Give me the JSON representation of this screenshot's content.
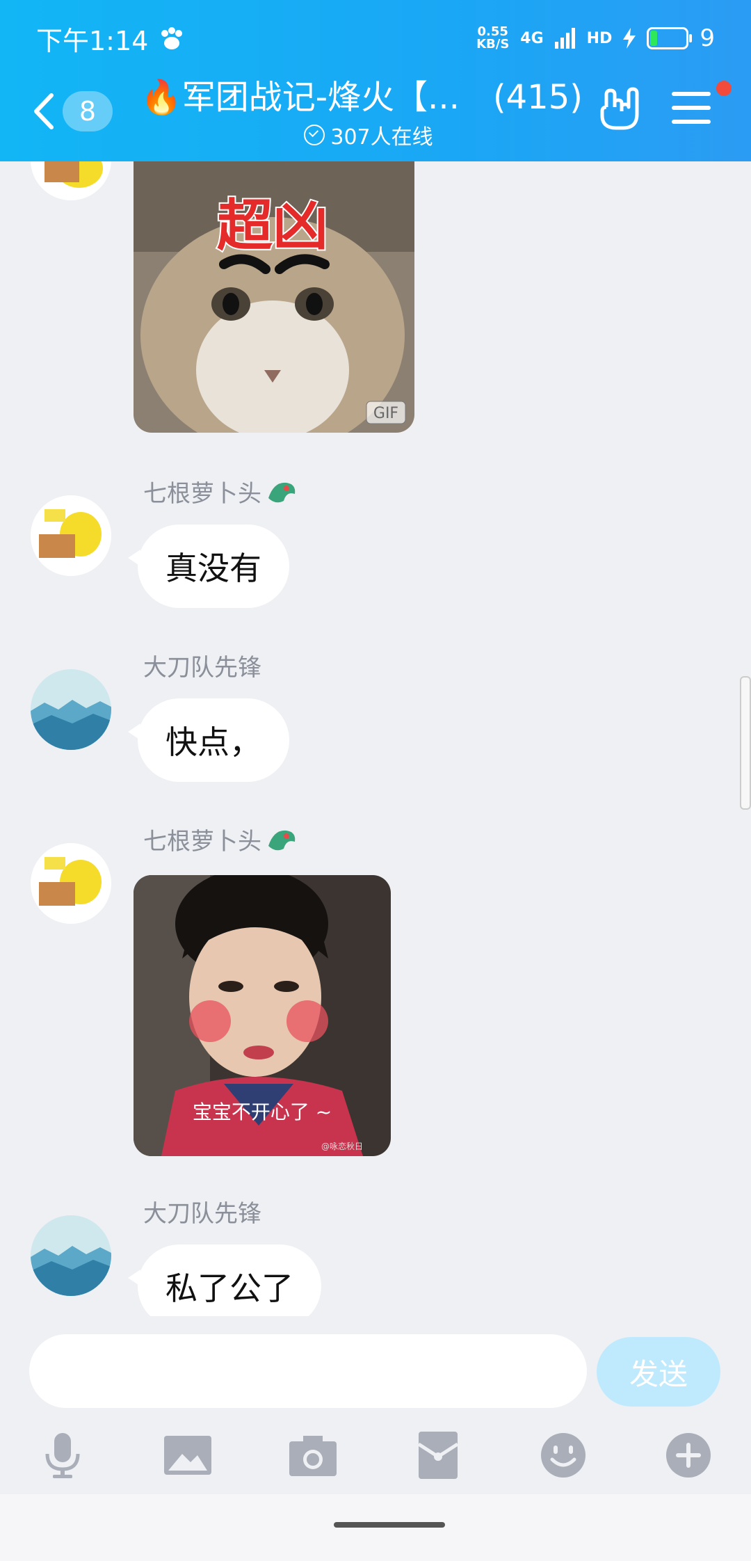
{
  "status": {
    "time": "下午1:14",
    "speed_top": "0.55",
    "speed_bottom": "KB/S",
    "network": "4G",
    "hd": "HD",
    "battery": "9"
  },
  "header": {
    "unread_count": "8",
    "title": "🔥军团战记-烽火【...　(415)",
    "online": "307人在线"
  },
  "messages": [
    {
      "type": "image",
      "caption": "超凶",
      "badge": "GIF"
    },
    {
      "type": "text",
      "sender": "七根萝卜头",
      "text": "真没有"
    },
    {
      "type": "text",
      "sender": "大刀队先锋",
      "text": "快点，"
    },
    {
      "type": "image",
      "sender": "七根萝卜头",
      "caption": "宝宝不开心了 ~",
      "watermark": "@咏恋秋日"
    },
    {
      "type": "text",
      "sender": "大刀队先锋",
      "text": "私了公了"
    }
  ],
  "composer": {
    "send_label": "发送",
    "input_value": "",
    "tools": [
      "microphone-icon",
      "image-icon",
      "camera-icon",
      "red-packet-icon",
      "emoji-icon",
      "plus-icon"
    ]
  },
  "colors": {
    "header": "#1aa7f5",
    "send": "#bfeafd",
    "background": "#eef0f4",
    "notify_dot": "#f24a3b"
  }
}
